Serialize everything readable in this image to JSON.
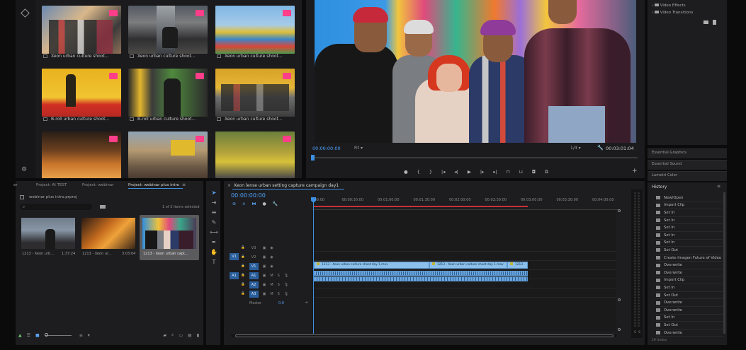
{
  "media_grid": {
    "items": [
      {
        "caption": "Xeon urban culture shoot..."
      },
      {
        "caption": "Xeon urban culture shoot..."
      },
      {
        "caption": "Xeon urban culture shoot..."
      },
      {
        "caption": "B-roll urban culture shoot..."
      },
      {
        "caption": "B-roll urban culture shoot..."
      },
      {
        "caption": "Xeon urban culture shoot..."
      }
    ]
  },
  "program_monitor": {
    "timecode_left": "00:00:00:00",
    "fit_label": "Fit",
    "resolution": "1/4",
    "timecode_right": "00:03:01:04"
  },
  "right_panels": {
    "effects_items": [
      "Video Effects",
      "Video Transitions"
    ],
    "panels": [
      "Essential Graphics",
      "Essential Sound",
      "Lumetri Color"
    ],
    "history_title": "History",
    "history_items": [
      "New/Open",
      "Import Clip",
      "Set In",
      "Set In",
      "Set In",
      "Set In",
      "Set In",
      "Set Out",
      "Create Imagen Future of Video",
      "Overwrite",
      "Overwrite",
      "Import Clip",
      "Set In",
      "Set Out",
      "Overwrite",
      "Overwrite",
      "Set In",
      "Set Out",
      "Overwrite"
    ],
    "bottom_label": "19 Undos"
  },
  "project_panel": {
    "tabs": [
      "er",
      "Project: AI TEST",
      "Project: webinar",
      "Project: webinar plus intro"
    ],
    "file_name": "webinar plus intro.prproj",
    "selection_info": "1 of 3 items selected",
    "clips": [
      {
        "name": "1213 - Xeon urb...",
        "duration": "1:37:24"
      },
      {
        "name": "1213 - Xeon ur...",
        "duration": "3:03:04"
      },
      {
        "name": "1213 - Xeon urban capt...",
        "duration": ""
      }
    ]
  },
  "timeline": {
    "sequence_name": "Xeon lense urban setting capture campaign day1",
    "timecode": "00:00:00:00",
    "ruler": [
      ":00:00",
      "00:00:30:00",
      "00:01:00:00",
      "00:01:30:00",
      "00:02:00:00",
      "00:02:30:00",
      "00:03:00:00",
      "00:03:30:00",
      "00:04:00:00"
    ],
    "video_tracks": [
      "V3",
      "V2",
      "V1"
    ],
    "audio_tracks": [
      "A1",
      "A2",
      "A3"
    ],
    "source_v": "V1",
    "source_a": "A1",
    "master_label": "Master",
    "master_value": "0.0",
    "clips": [
      "1213 - Xeon urban culture shoot day 1.mov",
      "1213 - Xeon urban culture shoot day 1.mov",
      "1213 -"
    ],
    "meter_labels": [
      "S",
      "S"
    ]
  }
}
